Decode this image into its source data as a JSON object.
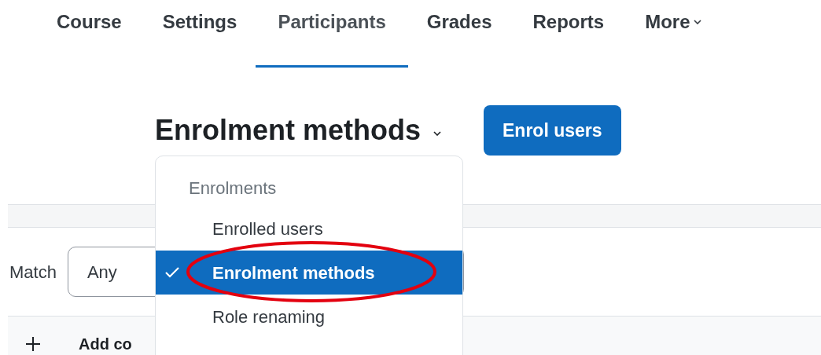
{
  "nav": {
    "tabs": [
      {
        "label": "Course",
        "selected": false,
        "kind": "link"
      },
      {
        "label": "Settings",
        "selected": false,
        "kind": "link"
      },
      {
        "label": "Participants",
        "selected": true,
        "kind": "link"
      },
      {
        "label": "Grades",
        "selected": false,
        "kind": "link"
      },
      {
        "label": "Reports",
        "selected": false,
        "kind": "link"
      },
      {
        "label": "More",
        "selected": false,
        "kind": "menu"
      }
    ]
  },
  "heading": {
    "title": "Enrolment methods",
    "button": "Enrol users"
  },
  "filter": {
    "label": "Match",
    "value": "Any"
  },
  "add_condition": {
    "label": "Add co"
  },
  "menu": {
    "items": [
      {
        "kind": "header",
        "label": "Enrolments"
      },
      {
        "kind": "item",
        "label": "Enrolled users",
        "selected": false
      },
      {
        "kind": "item",
        "label": "Enrolment methods",
        "selected": true
      },
      {
        "kind": "item",
        "label": "Role renaming",
        "selected": false
      }
    ]
  },
  "annotation": {
    "kind": "ellipse"
  }
}
